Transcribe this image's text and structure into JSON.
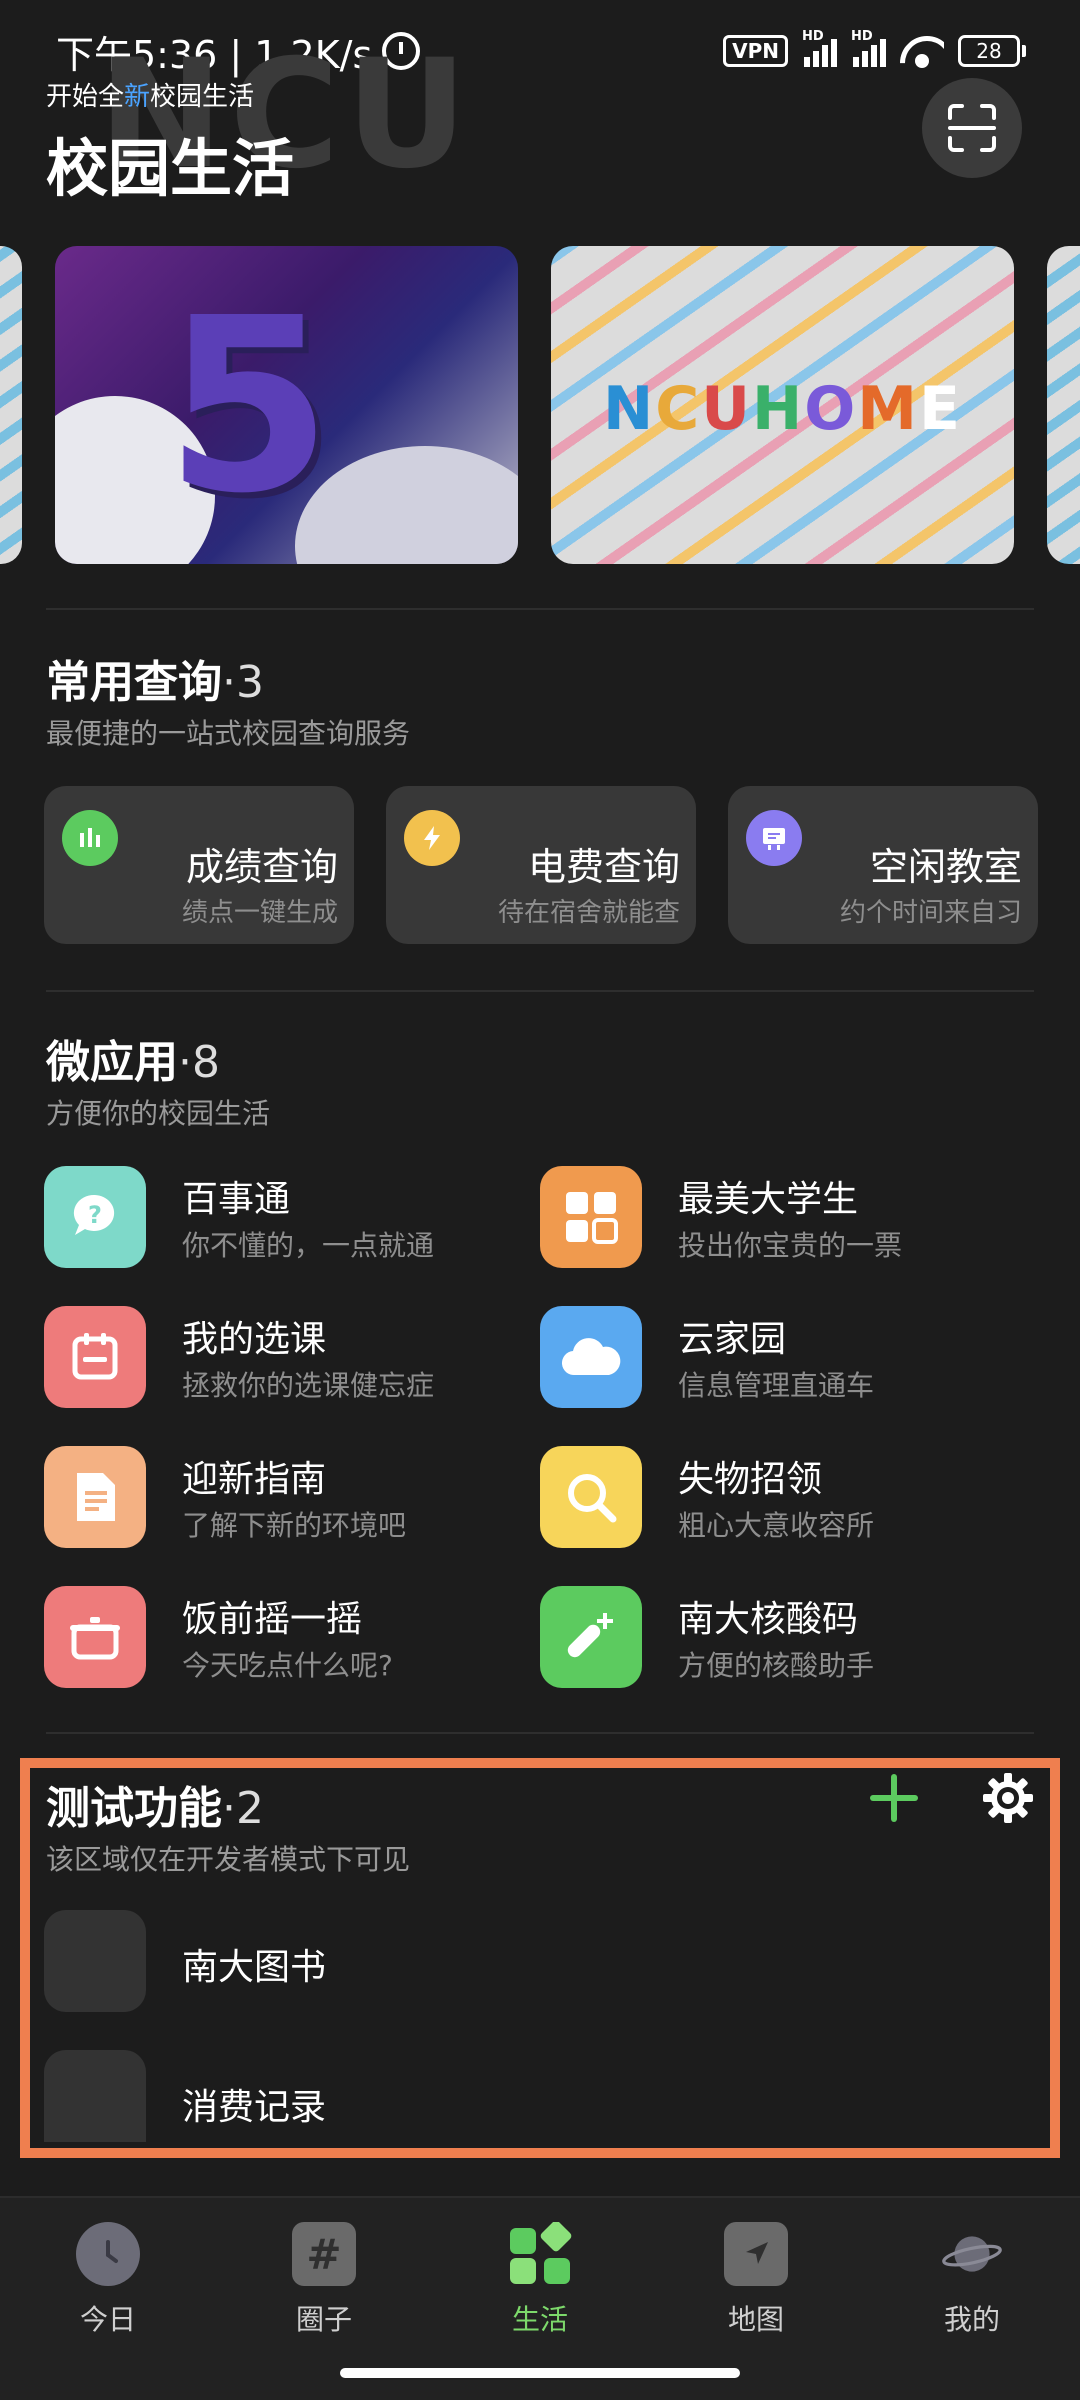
{
  "status_bar": {
    "time_speed": "下午5:36 | 1.2K/s",
    "vpn": "VPN",
    "hd1": "HD",
    "hd2": "HD",
    "battery": "28"
  },
  "header": {
    "subtitle_prefix": "开始全",
    "subtitle_highlight": "新",
    "subtitle_suffix": "校园生活",
    "title": "校园生活",
    "watermark": "NCU",
    "scan_icon": "scan-icon"
  },
  "banners": {
    "banner1_text": "5",
    "banner2_letters": [
      "N",
      "C",
      "U",
      "H",
      "O",
      "M",
      "E"
    ]
  },
  "common_query": {
    "title": "常用查询",
    "count": "·3",
    "subtitle": "最便捷的一站式校园查询服务",
    "cards": [
      {
        "name": "成绩查询",
        "desc": "绩点一键生成",
        "icon": "chart-icon",
        "color": "#5ccb5f"
      },
      {
        "name": "电费查询",
        "desc": "待在宿舍就能查",
        "icon": "lightning-icon",
        "color": "#f2c14e"
      },
      {
        "name": "空闲教室",
        "desc": "约个时间来自习",
        "icon": "board-icon",
        "color": "#8a7cf0"
      }
    ]
  },
  "micro_apps": {
    "title": "微应用",
    "count": "·8",
    "subtitle": "方便你的校园生活",
    "apps": [
      {
        "name": "百事通",
        "desc": "你不懂的，一点就通",
        "icon": "question-icon",
        "color": "#7ed9c9"
      },
      {
        "name": "最美大学生",
        "desc": "投出你宝贵的一票",
        "icon": "grid-icon",
        "color": "#f09a4e"
      },
      {
        "name": "我的选课",
        "desc": "拯救你的选课健忘症",
        "icon": "calendar-icon",
        "color": "#ee7b7b"
      },
      {
        "name": "云家园",
        "desc": "信息管理直通车",
        "icon": "cloud-icon",
        "color": "#5aa9f0"
      },
      {
        "name": "迎新指南",
        "desc": "了解下新的环境吧",
        "icon": "document-icon",
        "color": "#f4b183"
      },
      {
        "name": "失物招领",
        "desc": "粗心大意收容所",
        "icon": "magnifier-icon",
        "color": "#f7d55a"
      },
      {
        "name": "饭前摇一摇",
        "desc": "今天吃点什么呢?",
        "icon": "pot-icon",
        "color": "#ee7b7b"
      },
      {
        "name": "南大核酸码",
        "desc": "方便的核酸助手",
        "icon": "test-tube-icon",
        "color": "#5ccb5f"
      }
    ]
  },
  "test_features": {
    "title": "测试功能",
    "count": "·2",
    "subtitle": "该区域仅在开发者模式下可见",
    "items": [
      {
        "name": "南大图书"
      },
      {
        "name": "消费记录"
      }
    ],
    "highlight_color": "#ef7f4f"
  },
  "bottom_nav": {
    "tabs": [
      {
        "label": "今日",
        "icon": "clock-icon"
      },
      {
        "label": "圈子",
        "icon": "hash-icon"
      },
      {
        "label": "生活",
        "icon": "apps-icon",
        "active": true
      },
      {
        "label": "地图",
        "icon": "map-icon"
      },
      {
        "label": "我的",
        "icon": "planet-icon"
      }
    ],
    "active_color": "#7dd96b"
  }
}
